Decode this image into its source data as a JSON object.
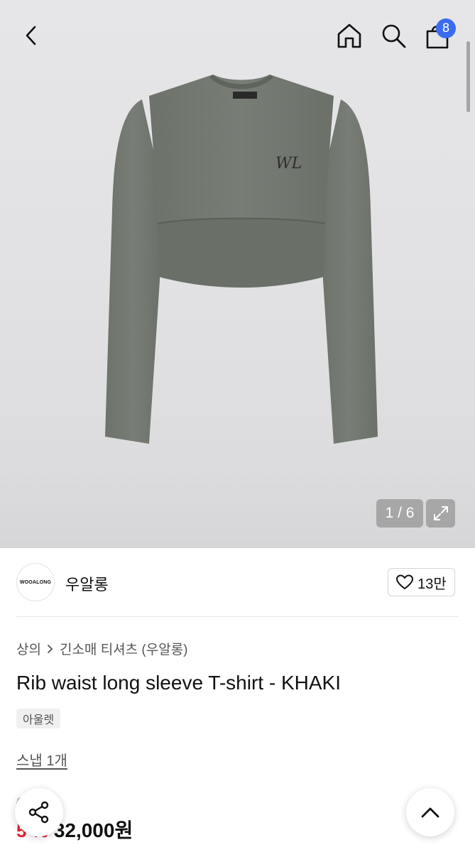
{
  "header": {
    "cart_count": "8"
  },
  "gallery": {
    "counter": "1 / 6",
    "logo_text": "WOOALONG"
  },
  "brand": {
    "logo_text": "WOOALONG",
    "name": "우알롱",
    "likes": "13만"
  },
  "product": {
    "breadcrumb": [
      "상의",
      "긴소매 티셔츠 (우알롱)"
    ],
    "title": "Rib waist long sleeve T-shirt - KHAKI",
    "tag": "아울렛",
    "snap_link": "스냅 1개",
    "original_price": "6 0원",
    "discount": "5 %",
    "price": "32,000원"
  },
  "colors": {
    "badge": "#3b6cf0",
    "discount": "#e8222e",
    "garment": "#737871"
  }
}
